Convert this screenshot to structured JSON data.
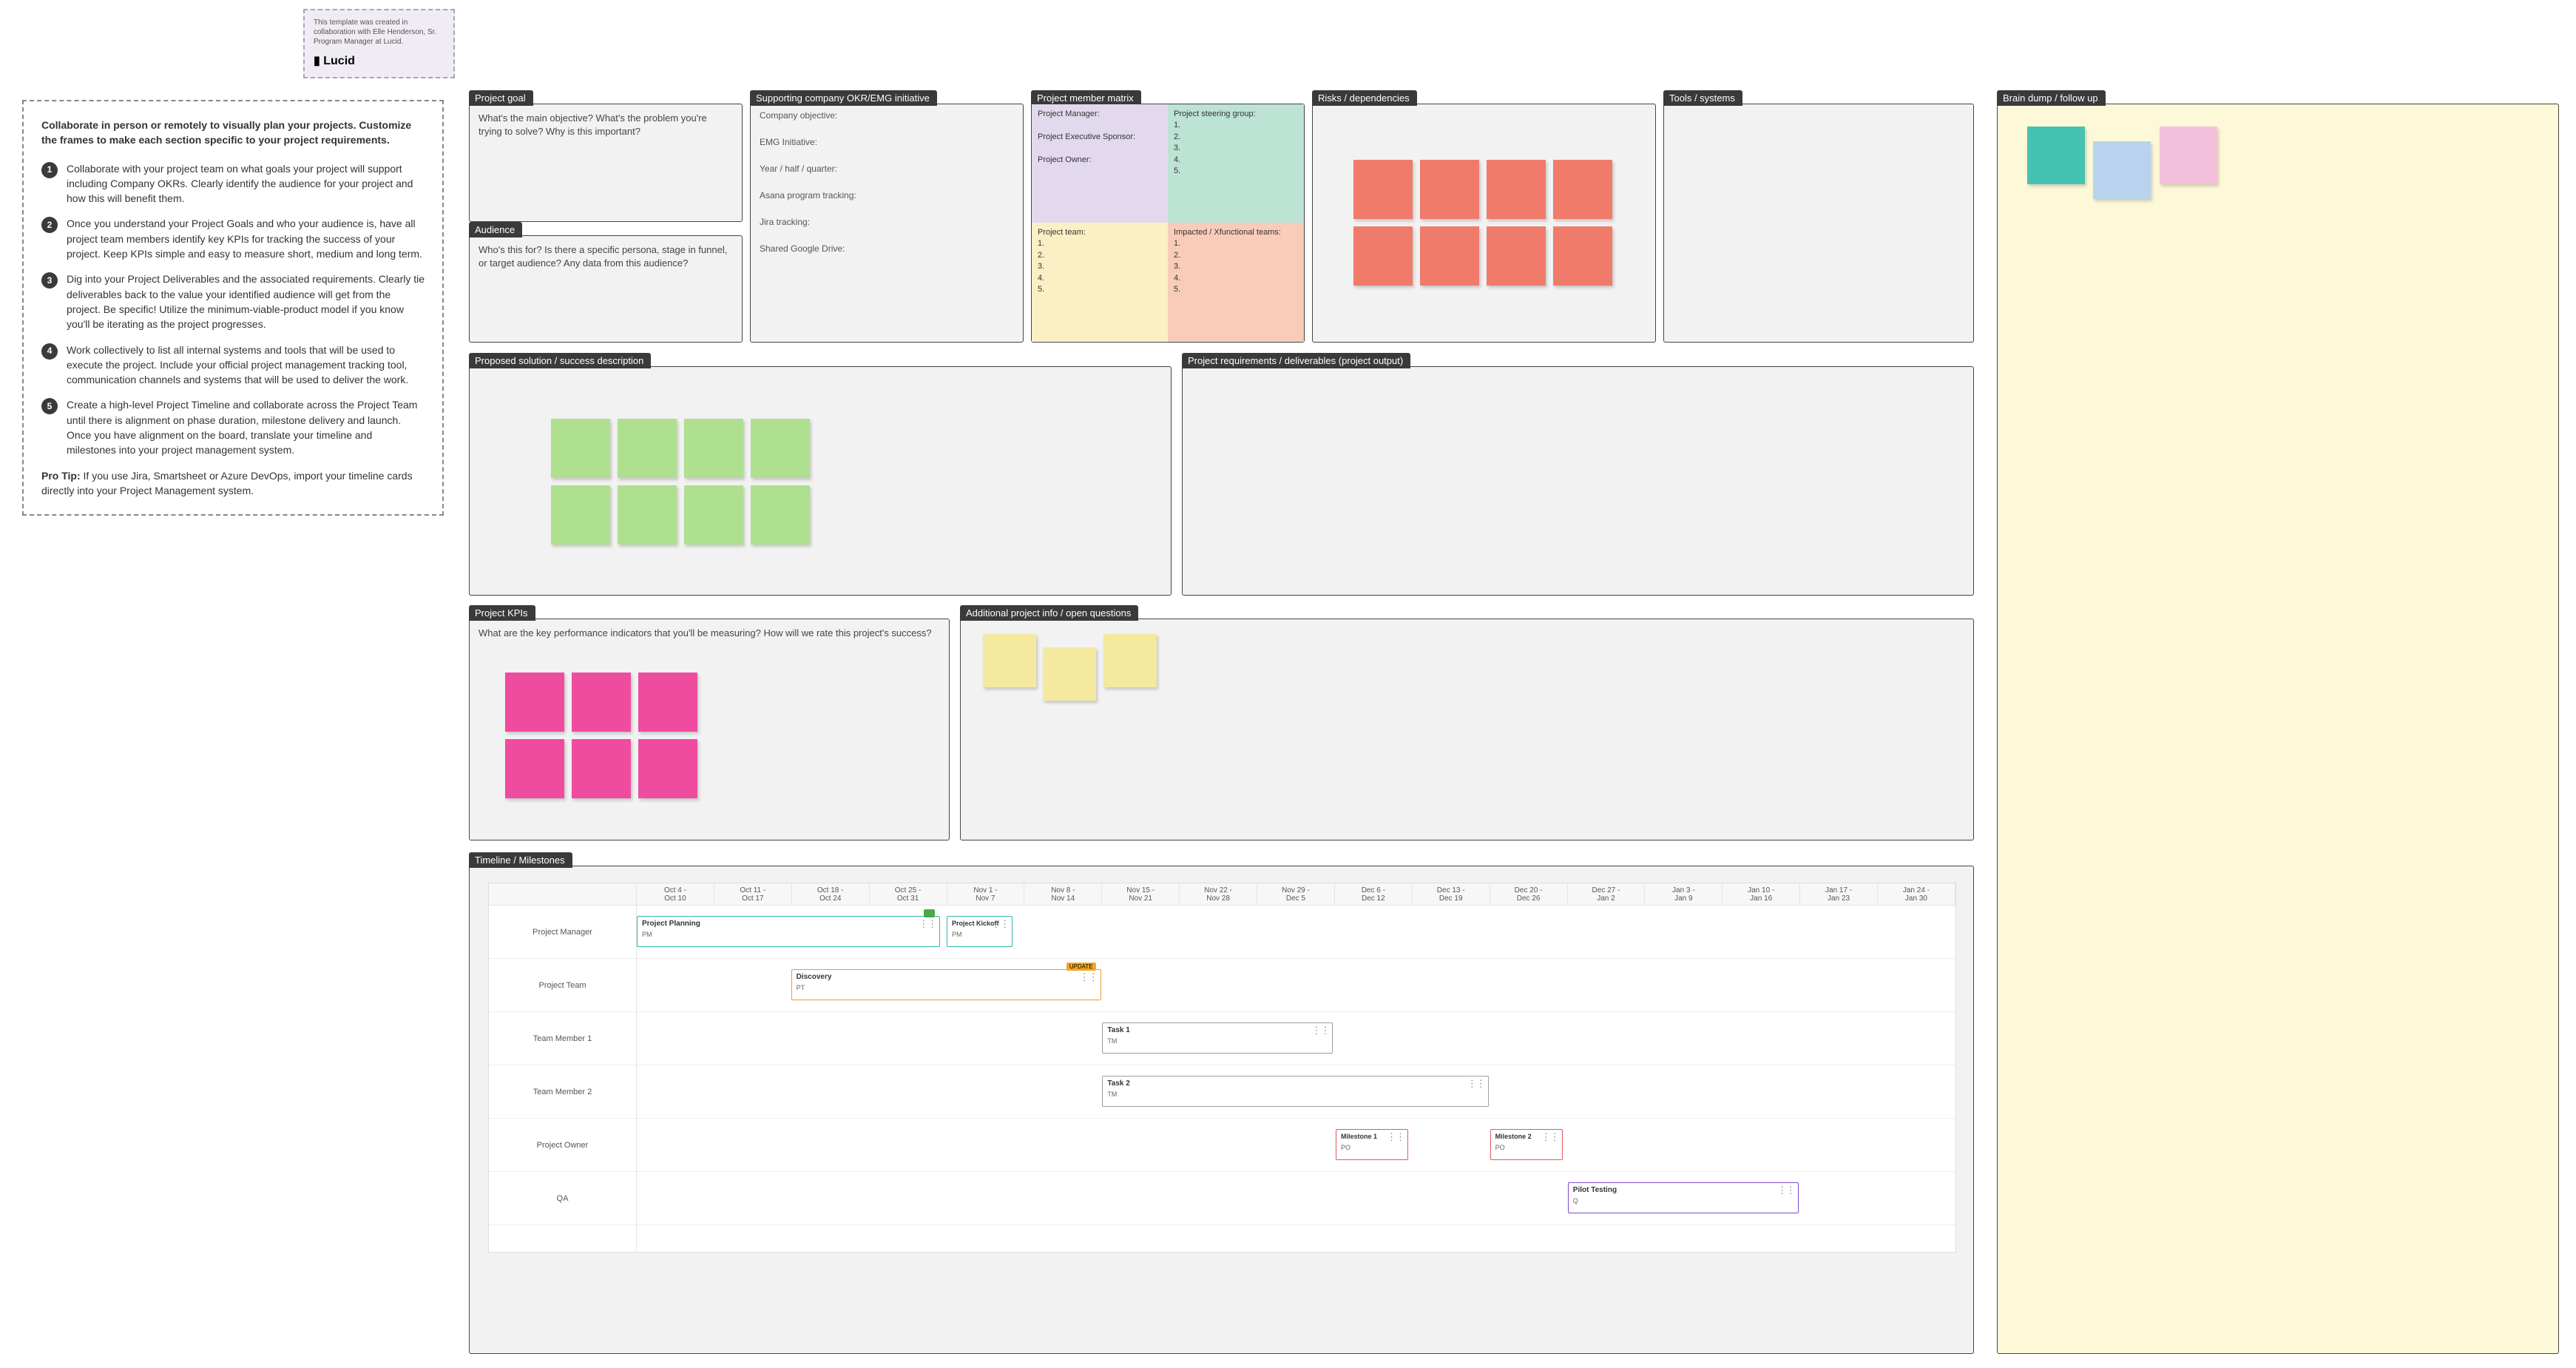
{
  "attribution": {
    "text": "This template was created in collaboration with Elle Henderson, Sr. Program Manager at Lucid.",
    "brand": "Lucid"
  },
  "instructions": {
    "lead": "Collaborate in person or remotely to visually plan your projects. Customize the frames to make each section specific to your project requirements.",
    "steps": [
      "Collaborate with your project team on what goals your project will support including Company OKRs. Clearly identify the audience for your project and how this will benefit them.",
      "Once you understand your Project Goals and who your audience is, have all project team members identify key KPIs for tracking the success of your project. Keep KPIs simple and easy to measure short, medium and long term.",
      "Dig into your Project Deliverables and the associated requirements. Clearly tie deliverables back to the value your identified audience will get from the project. Be specific! Utilize the minimum-viable-product model if you know you'll be iterating as the project progresses.",
      "Work collectively to list all internal systems and tools that will be used to execute the project. Include your official project management tracking tool, communication channels and systems that will be used to deliver the work.",
      "Create a high-level Project Timeline and collaborate across the Project Team until there is alignment on phase duration, milestone delivery and launch. Once you have alignment on the board, translate your timeline and milestones into your project management system."
    ],
    "protip_label": "Pro Tip:",
    "protip": "If you use Jira, Smartsheet or Azure DevOps, import your timeline cards directly into your Project Management system."
  },
  "frames": {
    "project_goal": {
      "title": "Project goal",
      "text": "What's the main objective? What's the problem you're trying to solve? Why is this important?"
    },
    "audience": {
      "title": "Audience",
      "text": "Who's this for? Is there a specific persona, stage in funnel, or target audience? Any data from this audience?"
    },
    "okr": {
      "title": "Supporting company OKR/EMG initiative",
      "fields": [
        "Company objective:",
        "EMG Initiative:",
        "Year / half / quarter:",
        "Asana program tracking:",
        "Jira tracking:",
        "Shared Google Drive:"
      ]
    },
    "member_matrix": {
      "title": "Project member matrix",
      "left_top": "Project Manager:\n\nProject Executive Sponsor:\n\nProject Owner:",
      "right_top_label": "Project steering group:",
      "right_top_items": [
        "1.",
        "2.",
        "3.",
        "4.",
        "5."
      ],
      "left_bottom_label": "Project team:",
      "left_bottom_items": [
        "1.",
        "2.",
        "3.",
        "4.",
        "5."
      ],
      "right_bottom_label": "Impacted / Xfunctional teams:",
      "right_bottom_items": [
        "1.",
        "2.",
        "3.",
        "4.",
        "5."
      ]
    },
    "risks": {
      "title": "Risks / dependencies"
    },
    "tools": {
      "title": "Tools / systems"
    },
    "proposed": {
      "title": "Proposed solution / success description"
    },
    "requirements": {
      "title": "Project requirements / deliverables (project output)"
    },
    "kpis": {
      "title": "Project KPIs",
      "text": "What are the key performance indicators that you'll be measuring? How will we rate this project's success?"
    },
    "additional": {
      "title": "Additional project info / open questions"
    },
    "timeline": {
      "title": "Timeline / Milestones"
    },
    "braindump": {
      "title": "Brain dump / follow up"
    }
  },
  "timeline": {
    "columns": [
      {
        "top": "Oct 4 -",
        "bot": "Oct 10"
      },
      {
        "top": "Oct 11 -",
        "bot": "Oct 17"
      },
      {
        "top": "Oct 18 -",
        "bot": "Oct 24"
      },
      {
        "top": "Oct 25 -",
        "bot": "Oct 31"
      },
      {
        "top": "Nov 1 -",
        "bot": "Nov 7"
      },
      {
        "top": "Nov 8 -",
        "bot": "Nov 14"
      },
      {
        "top": "Nov 15 -",
        "bot": "Nov 21"
      },
      {
        "top": "Nov 22 -",
        "bot": "Nov 28"
      },
      {
        "top": "Nov 29 -",
        "bot": "Dec 5"
      },
      {
        "top": "Dec 6 -",
        "bot": "Dec 12"
      },
      {
        "top": "Dec 13 -",
        "bot": "Dec 19"
      },
      {
        "top": "Dec 20 -",
        "bot": "Dec 26"
      },
      {
        "top": "Dec 27 -",
        "bot": "Jan 2"
      },
      {
        "top": "Jan 3 -",
        "bot": "Jan 9"
      },
      {
        "top": "Jan 10 -",
        "bot": "Jan 16"
      },
      {
        "top": "Jan 17 -",
        "bot": "Jan 23"
      },
      {
        "top": "Jan 24 -",
        "bot": "Jan 30"
      }
    ],
    "roles": [
      "Project Manager",
      "Project Team",
      "Team Member 1",
      "Team Member 2",
      "Project Owner",
      "QA"
    ],
    "tasks": {
      "plan": {
        "name": "Project Planning",
        "owner": "PM",
        "chip": "green"
      },
      "kickoff": {
        "name": "Project Kickoff",
        "owner": "PM"
      },
      "discovery": {
        "name": "Discovery",
        "owner": "PT",
        "chip": "oran"
      },
      "task1": {
        "name": "Task 1",
        "owner": "TM"
      },
      "task2": {
        "name": "Task 2",
        "owner": "TM"
      },
      "ms1": {
        "name": "Milestone 1",
        "owner": "PO"
      },
      "ms2": {
        "name": "Milestone 2",
        "owner": "PO"
      },
      "pilot": {
        "name": "Pilot Testing",
        "owner": "Q"
      }
    }
  }
}
